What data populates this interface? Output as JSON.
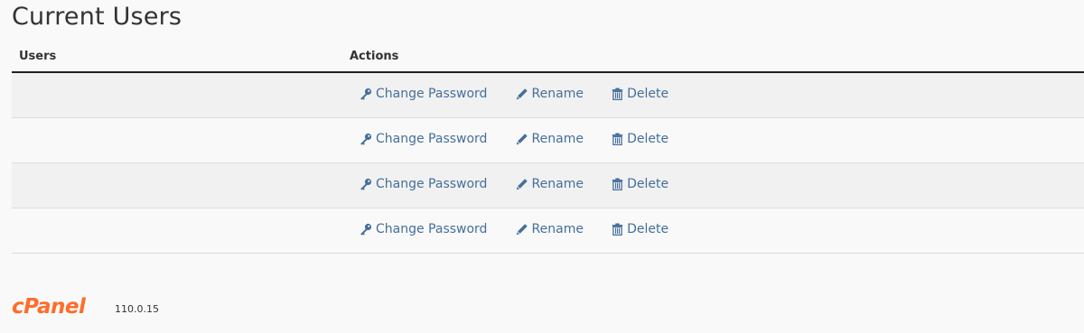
{
  "page": {
    "title": "Current Users"
  },
  "table": {
    "headers": {
      "users": "Users",
      "actions": "Actions"
    },
    "rows": [
      {
        "user": "",
        "change_password": "Change Password",
        "rename": "Rename",
        "delete": "Delete"
      },
      {
        "user": "",
        "change_password": "Change Password",
        "rename": "Rename",
        "delete": "Delete"
      },
      {
        "user": "",
        "change_password": "Change Password",
        "rename": "Rename",
        "delete": "Delete"
      },
      {
        "user": "",
        "change_password": "Change Password",
        "rename": "Rename",
        "delete": "Delete"
      }
    ]
  },
  "footer": {
    "logo_text": "cPanel",
    "version": "110.0.15"
  },
  "icons": {
    "change_password": "key-icon",
    "rename": "pencil-icon",
    "delete": "trash-icon"
  },
  "colors": {
    "link": "#456f9a",
    "brand": "#ff6c2c",
    "header_border": "#222222",
    "row_stripe": "#f1f1f1"
  }
}
